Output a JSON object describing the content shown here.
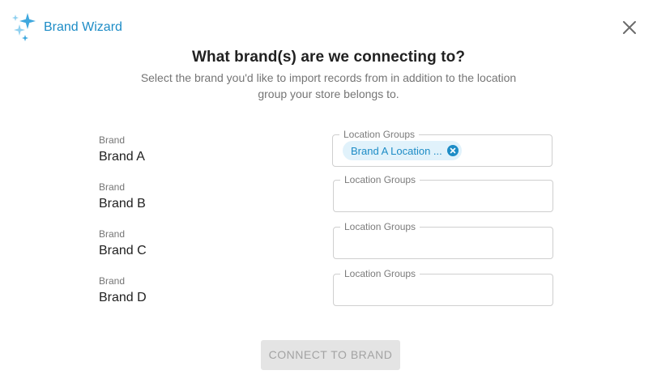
{
  "header": {
    "title": "Brand Wizard",
    "icon": "sparkle-icon",
    "accent_color": "#1d8cc6"
  },
  "close": {
    "icon": "close-icon"
  },
  "main": {
    "heading": "What brand(s) are we connecting to?",
    "subtitle_line1": "Select the brand you'd like to import records from in addition to the location",
    "subtitle_line2": "group your store belongs to."
  },
  "brands": [
    {
      "label": "Brand",
      "name": "Brand A",
      "field_label": "Location Groups",
      "chip": "Brand A Location ..."
    },
    {
      "label": "Brand",
      "name": "Brand B",
      "field_label": "Location Groups"
    },
    {
      "label": "Brand",
      "name": "Brand C",
      "field_label": "Location Groups"
    },
    {
      "label": "Brand",
      "name": "Brand D",
      "field_label": "Location Groups"
    }
  ],
  "footer": {
    "connect_label": "CONNECT TO BRAND",
    "connect_disabled": true
  }
}
